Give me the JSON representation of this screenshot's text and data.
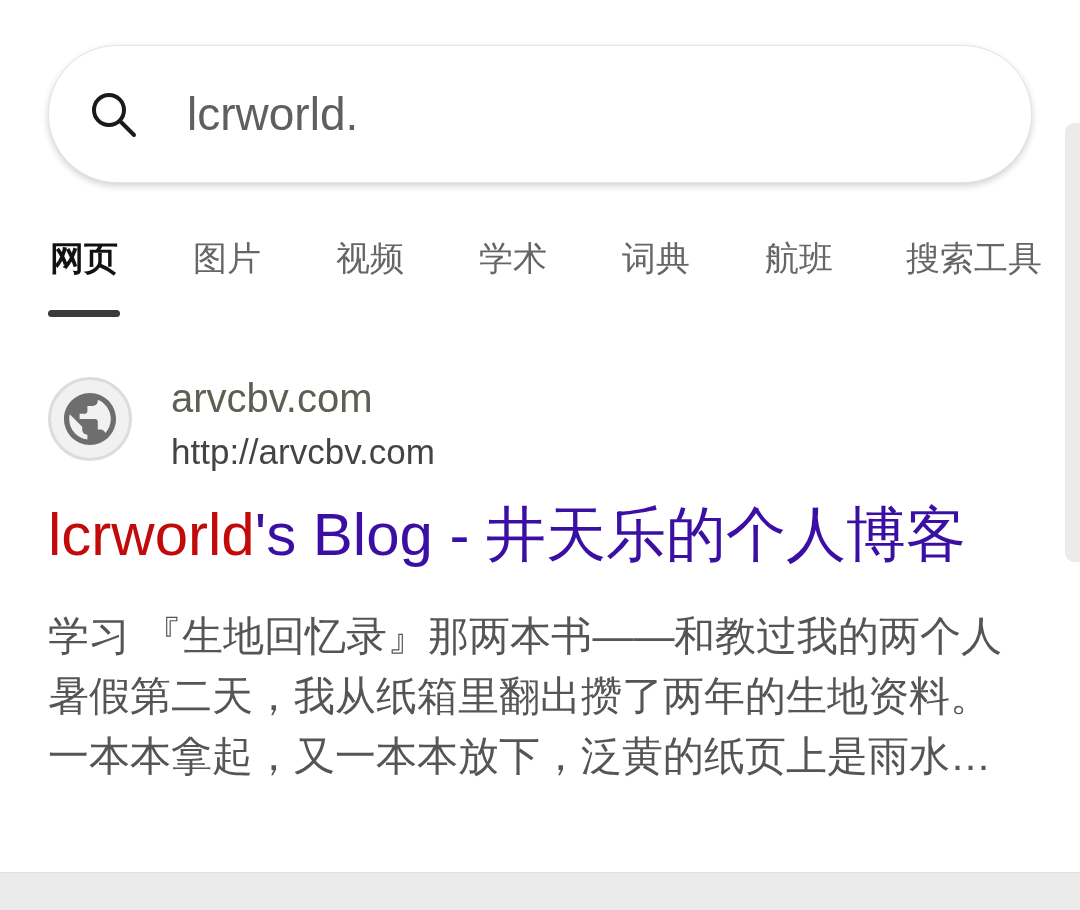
{
  "search": {
    "query": "lcrworld."
  },
  "tabs": [
    {
      "label": "网页",
      "selected": true
    },
    {
      "label": "图片",
      "selected": false
    },
    {
      "label": "视频",
      "selected": false
    },
    {
      "label": "学术",
      "selected": false
    },
    {
      "label": "词典",
      "selected": false
    },
    {
      "label": "航班",
      "selected": false
    },
    {
      "label": "搜索工具",
      "selected": false
    }
  ],
  "results": [
    {
      "site_name": "arvcbv.com",
      "url": "http://arvcbv.com",
      "title": [
        {
          "text": "lcrworld",
          "highlight": true
        },
        {
          "text": "'s Blog - 井天乐的个人博客",
          "highlight": false
        }
      ],
      "snippet_lines": [
        "学习 『生地回忆录』那两本书——和教过我的两个人",
        "暑假第二天，我从纸箱里翻出攒了两年的生地资料。",
        "一本本拿起，又一本本放下，泛黄的纸页上是雨水…"
      ]
    }
  ]
}
